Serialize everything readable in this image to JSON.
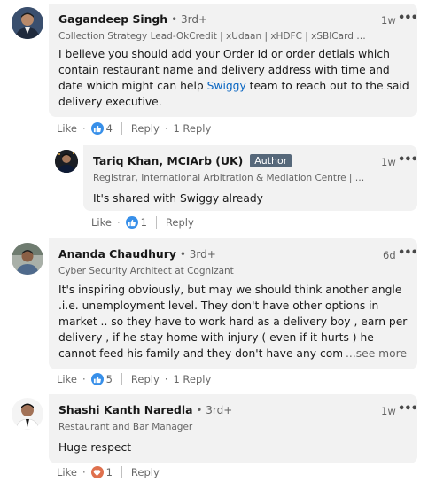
{
  "comments": [
    {
      "name": "Gagandeep Singh",
      "degree": "• 3rd+",
      "headline": "Collection Strategy Lead-OkCredit | xUdaan | xHDFC | xSBICard | xP...",
      "time": "1w",
      "more": "•••",
      "body_part1": "I believe you should add your Order Id or order detials which contain restaurant name and delivery address with time and date which might can help ",
      "body_link": "Swiggy",
      "body_part2": " team to reach out to the said delivery executive.",
      "like": "Like",
      "reaction_count": "4",
      "reply": "Reply",
      "replies": "1 Reply"
    },
    {
      "name": "Tariq Khan, MCIArb (UK)",
      "author_badge": "Author",
      "headline": "Registrar, International Arbitration & Mediation Centre | A...",
      "time": "1w",
      "more": "•••",
      "body": "It's shared with Swiggy already",
      "like": "Like",
      "reaction_count": "1",
      "reply": "Reply"
    },
    {
      "name": "Ananda Chaudhury",
      "degree": "• 3rd+",
      "headline": "Cyber Security Architect at Cognizant",
      "time": "6d",
      "more": "•••",
      "body": "It's inspiring obviously, but may we should think another angle .i.e. unemployment level. They don't have other options in market .. so they have to work hard as a delivery boy , earn per delivery , if he stay home with injury ( even if it hurts ) he cannot feed his family and they don't have any company medical policy, accid",
      "see_more": "...see more",
      "like": "Like",
      "reaction_count": "5",
      "reply": "Reply",
      "replies": "1 Reply"
    },
    {
      "name": "Shashi Kanth Naredla",
      "degree": "• 3rd+",
      "headline": "Restaurant and Bar Manager",
      "time": "1w",
      "more": "•••",
      "body": "Huge respect",
      "like": "Like",
      "reaction_count": "1",
      "reply": "Reply"
    }
  ],
  "colors": {
    "bubble": "#f2f2f2",
    "link": "#0a66c2",
    "like": "#378fe9",
    "love": "#df704d",
    "badge": "#56687a"
  }
}
